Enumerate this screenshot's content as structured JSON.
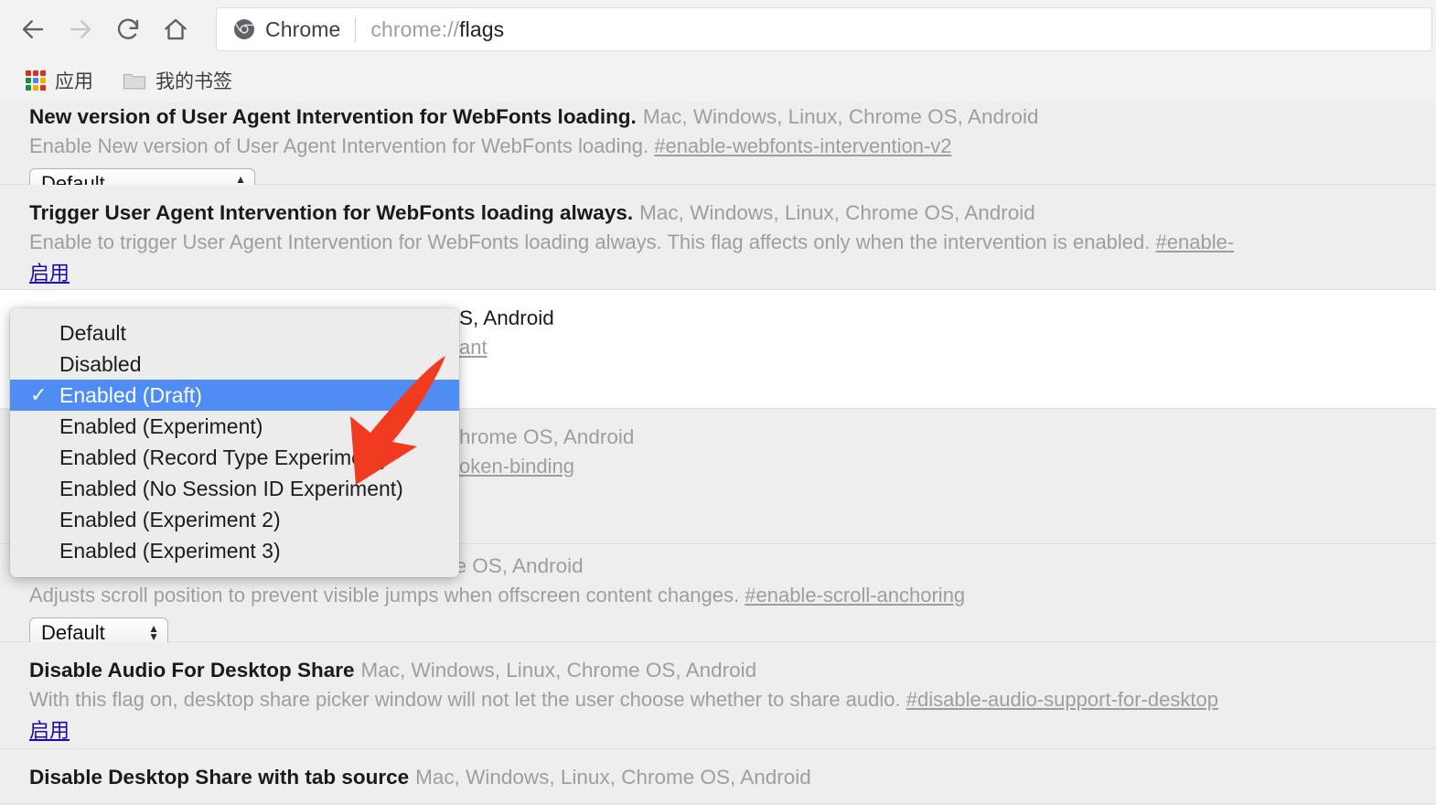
{
  "browser": {
    "nav": {
      "back": "back-arrow",
      "forward": "forward-arrow",
      "reload": "reload",
      "home": "home"
    },
    "omnibox": {
      "site_label": "Chrome",
      "url_scheme": "chrome://",
      "url_page": "flags",
      "full_url": "chrome://flags"
    },
    "bookmarks": [
      {
        "label": "应用",
        "icon": "apps-grid-icon"
      },
      {
        "label": "我的书签",
        "icon": "folder-icon"
      }
    ]
  },
  "flags": [
    {
      "name": "New version of User Agent Intervention for WebFonts loading.",
      "platforms": "Mac, Windows, Linux, Chrome OS, Android",
      "description": "Enable New version of User Agent Intervention for WebFonts loading.",
      "permalink": "#enable-webfonts-intervention-v2",
      "control": "select",
      "value": "Default",
      "highlight": false
    },
    {
      "name": "Trigger User Agent Intervention for WebFonts loading always.",
      "platforms": "Mac, Windows, Linux, Chrome OS, Android",
      "description": "Enable to trigger User Agent Intervention for WebFonts loading always. This flag affects only when the intervention is enabled.",
      "permalink": "#enable-",
      "control": "link",
      "value": "启用",
      "highlight": false
    },
    {
      "name": "",
      "platforms": "S, Android",
      "description": "",
      "permalink": "ant",
      "control": "none",
      "value": "",
      "highlight": true
    },
    {
      "name": "",
      "platforms": "hrome OS, Android",
      "description": "",
      "permalink": "oken-binding",
      "control": "none",
      "value": "",
      "highlight": false
    },
    {
      "name": "",
      "platforms": "Chrome OS, Android",
      "description": "Adjusts scroll position to prevent visible jumps when offscreen content changes.",
      "permalink": "#enable-scroll-anchoring",
      "control": "select",
      "value": "Default",
      "highlight": false
    },
    {
      "name": "Disable Audio For Desktop Share",
      "platforms": "Mac, Windows, Linux, Chrome OS, Android",
      "description": "With this flag on, desktop share picker window will not let the user choose whether to share audio.",
      "permalink": "#disable-audio-support-for-desktop",
      "control": "link",
      "value": "启用",
      "highlight": false
    },
    {
      "name": "Disable Desktop Share with tab source",
      "platforms": "Mac, Windows, Linux, Chrome OS, Android",
      "description": "",
      "permalink": "",
      "control": "none",
      "value": "",
      "highlight": false
    }
  ],
  "dropdown": {
    "selected_index": 2,
    "check_glyph": "✓",
    "options": [
      "Default",
      "Disabled",
      "Enabled (Draft)",
      "Enabled (Experiment)",
      "Enabled (Record Type Experiment)",
      "Enabled (No Session ID Experiment)",
      "Enabled (Experiment 2)",
      "Enabled (Experiment 3)"
    ]
  },
  "annotation": {
    "arrow_color": "#f03b20",
    "points_to": "Enabled (Draft)"
  },
  "colors": {
    "page_background": "#eeeeee",
    "toolbar_background": "#f2f2f2",
    "highlight_blue": "#4f8df5",
    "link_blue": "#1a0dab",
    "muted_text": "#9e9e9e",
    "arrow_red": "#f03b20"
  },
  "select_arrows": {
    "up": "▲",
    "down": "▼"
  }
}
